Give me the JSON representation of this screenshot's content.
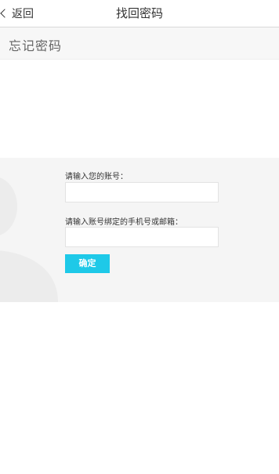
{
  "header": {
    "back_label": "返回",
    "title": "找回密码"
  },
  "section": {
    "title": "忘记密码"
  },
  "form": {
    "account_label": "请输入您的账号：",
    "account_value": "",
    "contact_label": "请输入账号绑定的手机号或邮箱：",
    "contact_value": "",
    "submit_label": "确定"
  },
  "colors": {
    "accent": "#1ec9e8",
    "panel_bg": "#f5f5f5",
    "header_bg": "#f7f7f7"
  },
  "icons": {
    "back": "chevron-left-icon",
    "avatar": "user-silhouette-icon"
  }
}
